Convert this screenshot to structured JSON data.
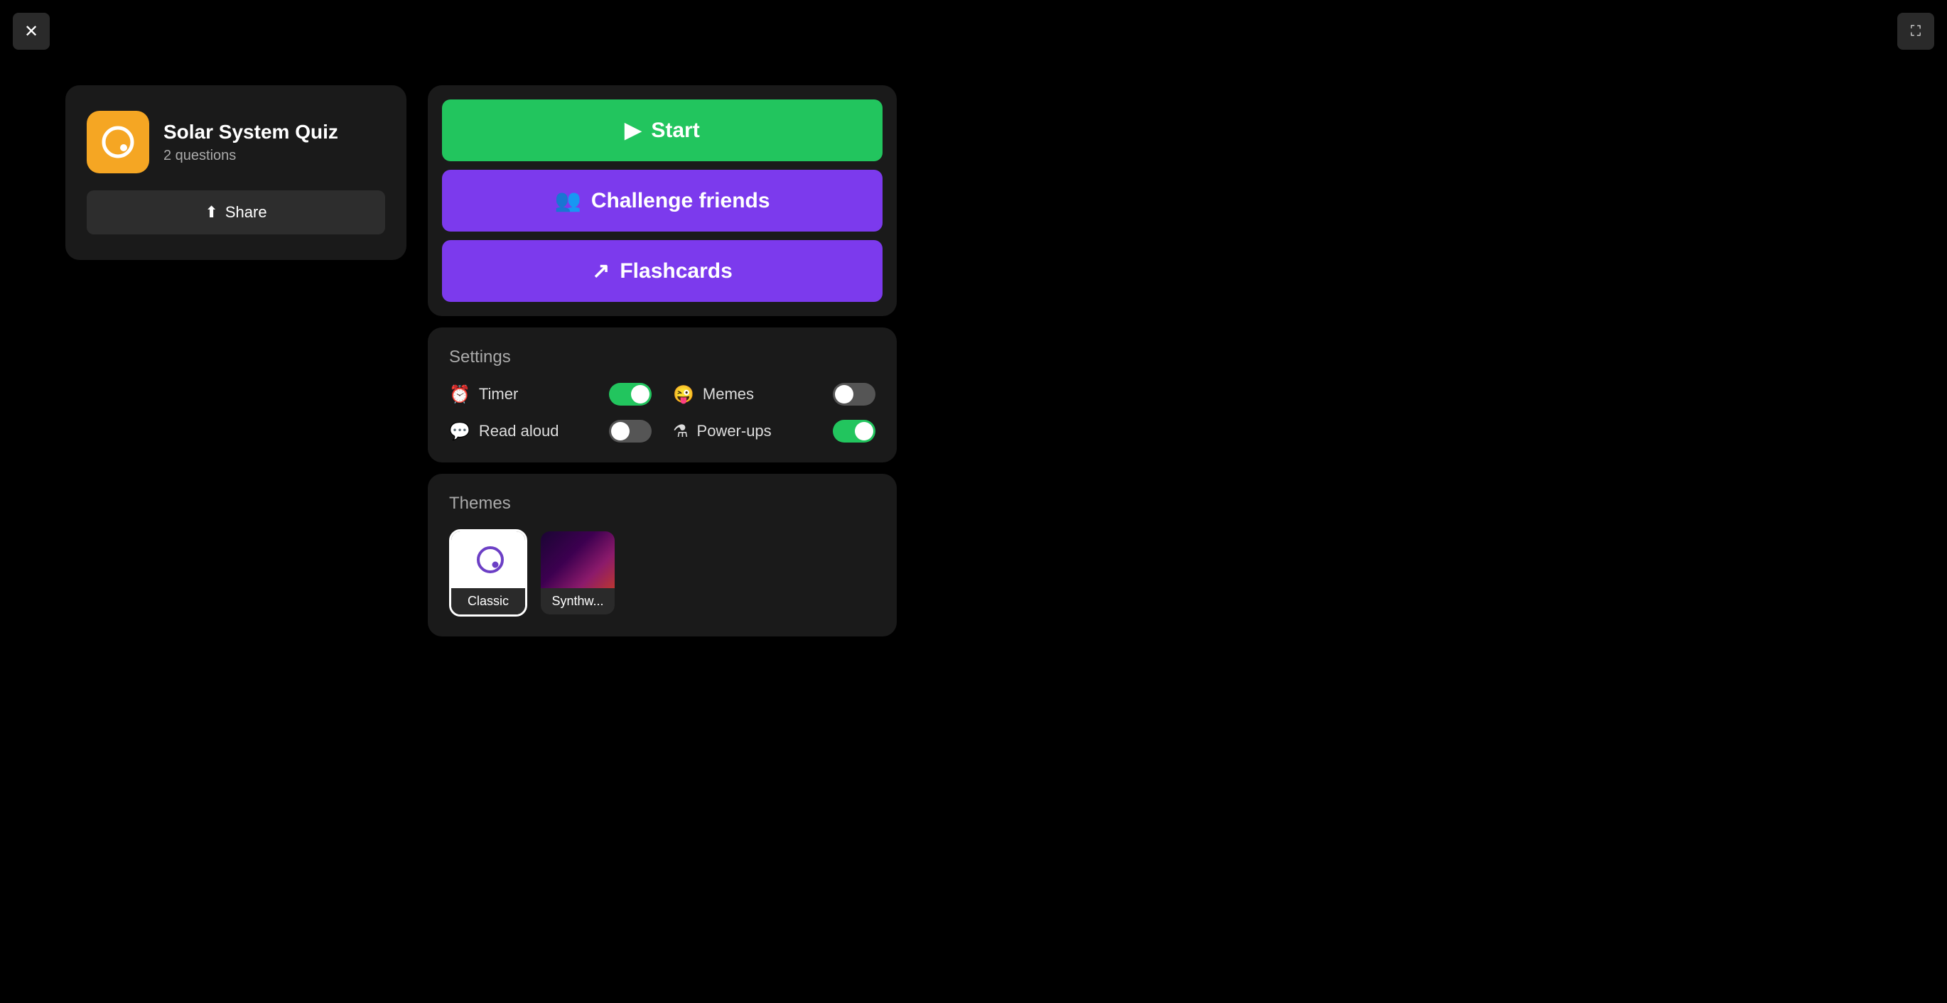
{
  "window": {
    "close_label": "✕",
    "fullscreen_label": "⛶"
  },
  "left_card": {
    "quiz_title": "Solar System Quiz",
    "quiz_questions": "2 questions",
    "share_label": "Share",
    "icon_bg": "#f5a623"
  },
  "action_buttons": {
    "start_label": "Start",
    "challenge_label": "Challenge friends",
    "flashcards_label": "Flashcards"
  },
  "settings": {
    "title": "Settings",
    "items": [
      {
        "id": "timer",
        "icon": "⏰",
        "label": "Timer",
        "on": true
      },
      {
        "id": "memes",
        "icon": "😜",
        "label": "Memes",
        "on": false
      },
      {
        "id": "read_aloud",
        "icon": "💬",
        "label": "Read aloud",
        "on": false
      },
      {
        "id": "powerups",
        "icon": "⚗",
        "label": "Power-ups",
        "on": true
      }
    ]
  },
  "themes": {
    "title": "Themes",
    "items": [
      {
        "id": "classic",
        "name": "Classic",
        "selected": true
      },
      {
        "id": "synthwave",
        "name": "Synthw...",
        "selected": false
      }
    ]
  },
  "colors": {
    "green": "#22c55e",
    "purple": "#7c3aed",
    "orange": "#f5a623",
    "dark_card": "#1a1a1a",
    "darker_bg": "#2a2a2a"
  }
}
